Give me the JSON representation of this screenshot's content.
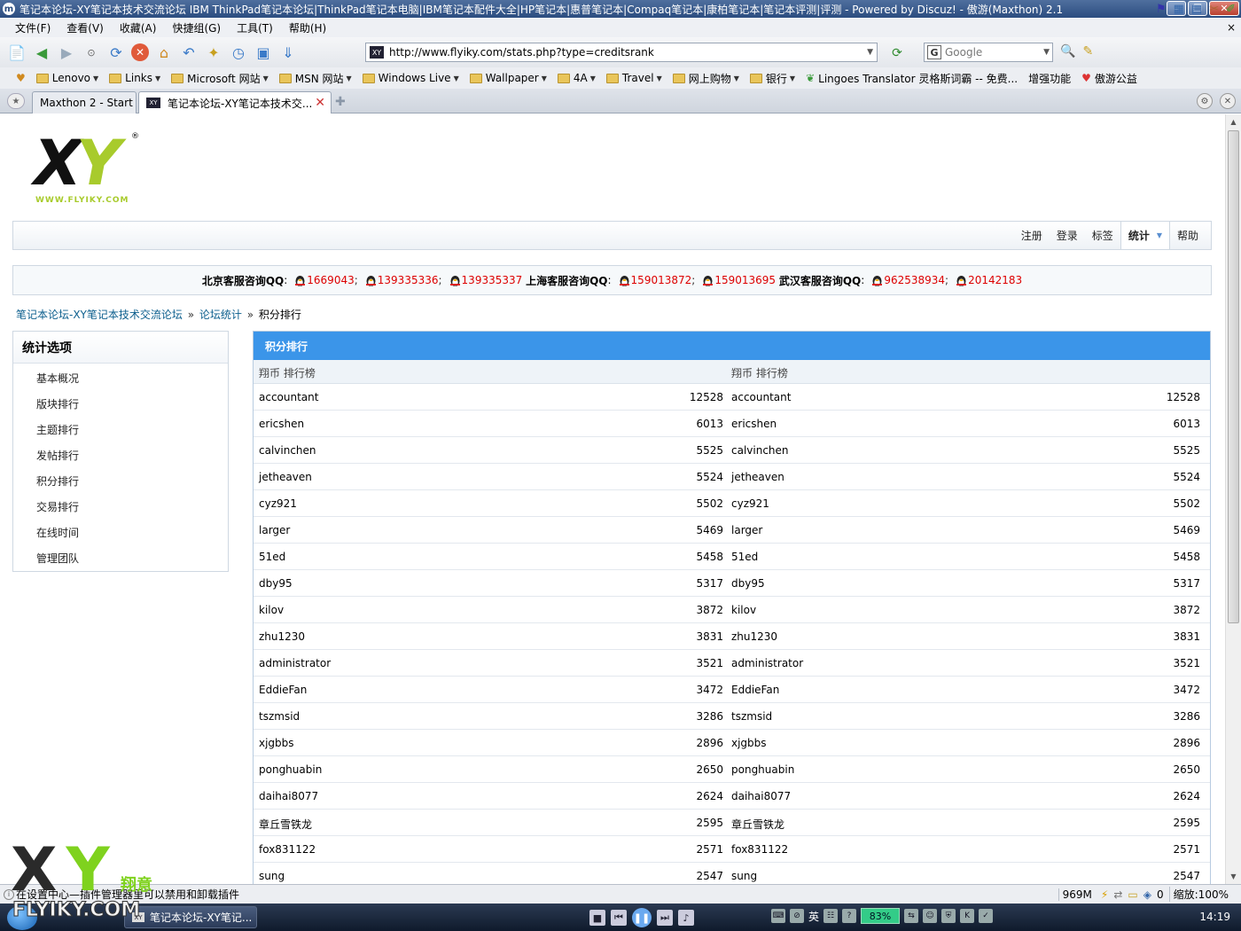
{
  "window": {
    "title": "笔记本论坛-XY笔记本技术交流论坛 IBM ThinkPad笔记本论坛|ThinkPad笔记本电脑|IBM笔记本配件大全|HP笔记本|惠普笔记本|Compaq笔记本|康柏笔记本|笔记本评测|评测 - Powered by Discuz! - 傲游(Maxthon) 2.1",
    "controls": [
      "minimize",
      "restore",
      "close"
    ]
  },
  "menu": {
    "items": [
      "文件(F)",
      "查看(V)",
      "收藏(A)",
      "快捷组(G)",
      "工具(T)",
      "帮助(H)"
    ],
    "close": "×"
  },
  "toolbar": {
    "url": "http://www.flyiky.com/stats.php?type=creditsrank",
    "search_placeholder": "Google"
  },
  "favorites": {
    "items": [
      {
        "label": "Lenovo",
        "dropdown": true
      },
      {
        "label": "Links",
        "dropdown": true
      },
      {
        "label": "Microsoft 网站",
        "dropdown": true
      },
      {
        "label": "MSN 网站",
        "dropdown": true
      },
      {
        "label": "Windows Live",
        "dropdown": true
      },
      {
        "label": "Wallpaper",
        "dropdown": true
      },
      {
        "label": "4A",
        "dropdown": true
      },
      {
        "label": "Travel",
        "dropdown": true
      },
      {
        "label": "网上购物",
        "dropdown": true
      },
      {
        "label": "银行",
        "dropdown": true
      }
    ],
    "lingoes": "Lingoes Translator 灵格斯词霸 -- 免费...",
    "enhance": "增强功能",
    "public": "傲游公益"
  },
  "tabs": [
    {
      "label": "Maxthon 2 - Start",
      "active": false
    },
    {
      "label": "笔记本论坛-XY笔记本技术交...",
      "active": true
    }
  ],
  "site": {
    "logo_text": "XY",
    "logo_reg": "®",
    "logo_url": "WWW.FLYIKY.COM",
    "nav": [
      {
        "label": "注册",
        "active": false
      },
      {
        "label": "登录",
        "active": false
      },
      {
        "label": "标签",
        "active": false
      },
      {
        "label": "统计",
        "active": true
      },
      {
        "label": "帮助",
        "active": false
      }
    ],
    "qq": {
      "beijing_label": "北京客服咨询QQ",
      "beijing": [
        "1669043",
        "139335336",
        "139335337"
      ],
      "shanghai_label": "上海客服咨询QQ",
      "shanghai": [
        "159013872",
        "159013695"
      ],
      "wuhan_label": "武汉客服咨询QQ",
      "wuhan": [
        "962538934",
        "20142183"
      ]
    },
    "breadcrumb": {
      "home": "笔记本论坛-XY笔记本技术交流论坛",
      "stats": "论坛统计",
      "current": "积分排行"
    }
  },
  "sidebar": {
    "title": "统计选项",
    "items": [
      "基本概况",
      "版块排行",
      "主题排行",
      "发帖排行",
      "积分排行",
      "交易排行",
      "在线时间",
      "管理团队"
    ]
  },
  "ranking": {
    "title": "积分排行",
    "left_header": "翔币  排行榜",
    "right_header": "翔币  排行榜",
    "rows": [
      {
        "name": "accountant",
        "value": "12528"
      },
      {
        "name": "ericshen",
        "value": "6013"
      },
      {
        "name": "calvinchen",
        "value": "5525"
      },
      {
        "name": "jetheaven",
        "value": "5524"
      },
      {
        "name": "cyz921",
        "value": "5502"
      },
      {
        "name": "larger",
        "value": "5469"
      },
      {
        "name": "51ed",
        "value": "5458"
      },
      {
        "name": "dby95",
        "value": "5317"
      },
      {
        "name": "kilov",
        "value": "3872"
      },
      {
        "name": "zhu1230",
        "value": "3831"
      },
      {
        "name": "administrator",
        "value": "3521"
      },
      {
        "name": "EddieFan",
        "value": "3472"
      },
      {
        "name": "tszmsid",
        "value": "3286"
      },
      {
        "name": "xjgbbs",
        "value": "2896"
      },
      {
        "name": "ponghuabin",
        "value": "2650"
      },
      {
        "name": "daihai8077",
        "value": "2624"
      },
      {
        "name": "章丘雪铁龙",
        "value": "2595"
      },
      {
        "name": "fox831122",
        "value": "2571"
      },
      {
        "name": "sung",
        "value": "2547"
      }
    ]
  },
  "statusbar": {
    "message": "在设置中心—插件管理器里可以禁用和卸载插件",
    "memory": "969M",
    "count": "0",
    "zoom": "缩放:100%"
  },
  "taskbar": {
    "item": "笔记本论坛-XY笔记...",
    "ime": "英",
    "battery": "83%",
    "clock": "14:19"
  },
  "watermark": {
    "letters": "XY",
    "cn": "翔意",
    "domain": "FLYIKY.COM"
  },
  "colors": {
    "panel_header": "#3b95e9",
    "link": "#0b5e8d",
    "qq_number": "#dd0000",
    "logo_green": "#a8cb2c"
  }
}
